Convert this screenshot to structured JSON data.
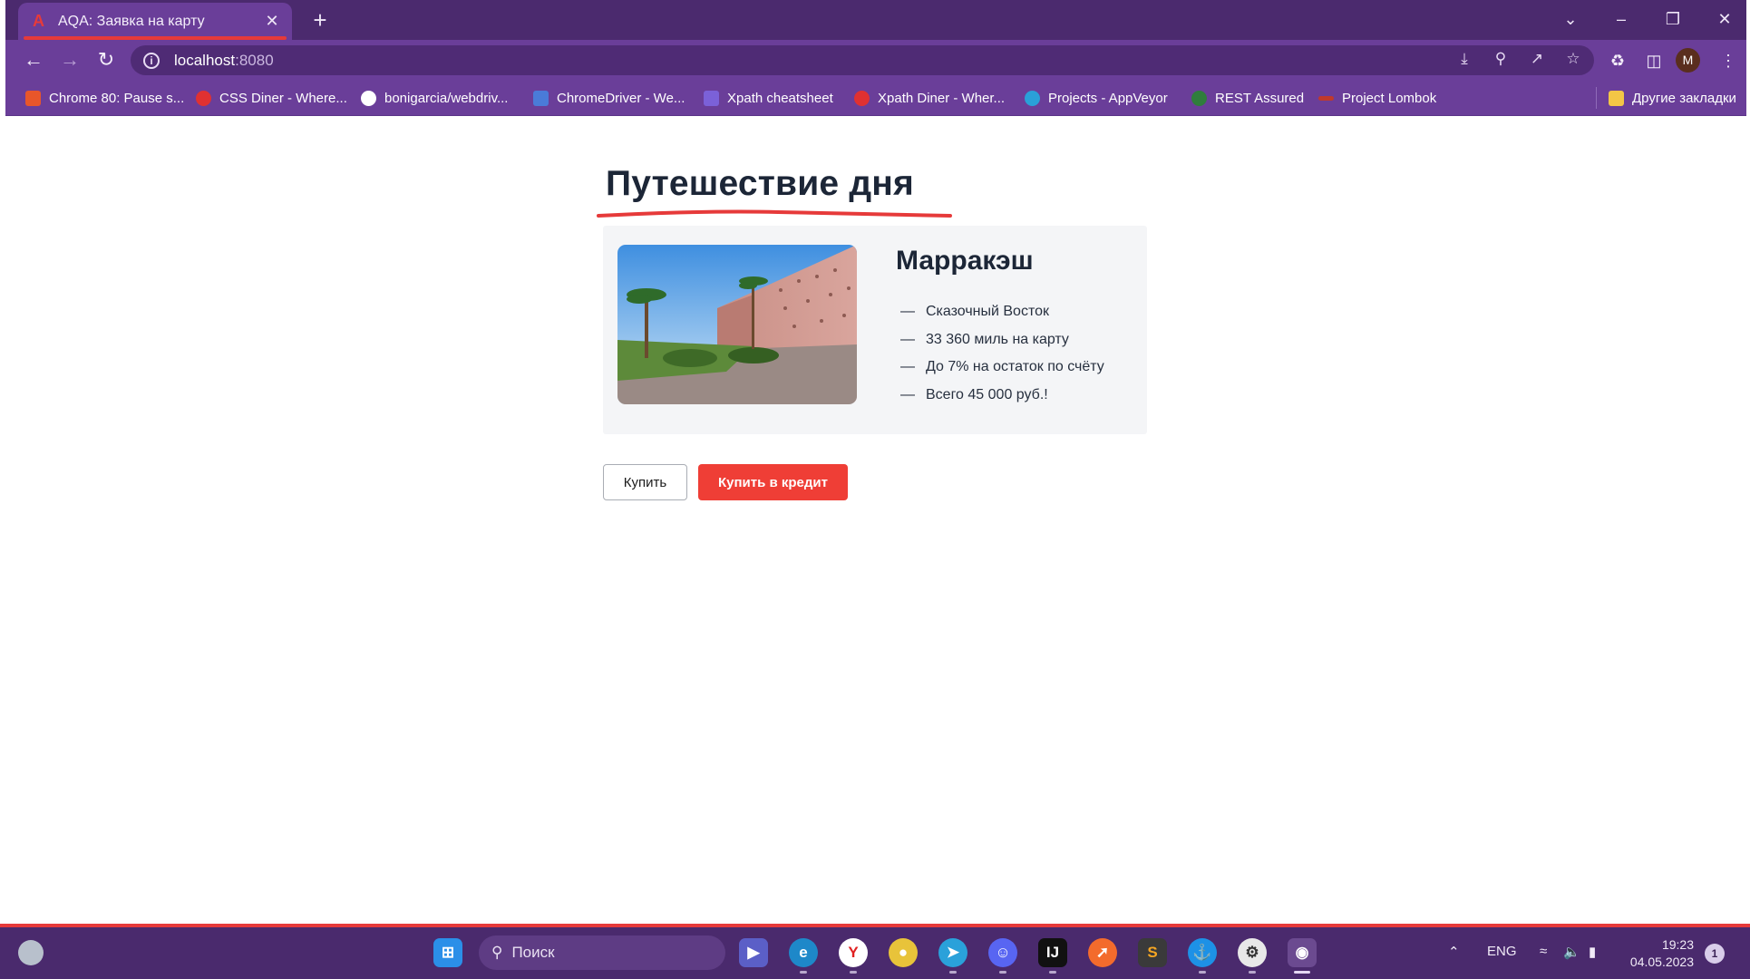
{
  "browser": {
    "tab_title": "AQA: Заявка на карту",
    "tab_close": "✕",
    "new_tab": "+",
    "url_host": "localhost",
    "url_port": ":8080",
    "avatar_letter": "M",
    "bookmarks": [
      {
        "label": "Chrome 80: Pause s...",
        "color": "#e8562a"
      },
      {
        "label": "CSS Diner - Where...",
        "color": "#e03131"
      },
      {
        "label": "bonigarcia/webdriv...",
        "color": "#ffffff"
      },
      {
        "label": "ChromeDriver - We...",
        "color": "#4a7bd8"
      },
      {
        "label": "Xpath cheatsheet",
        "color": "#7b61d8"
      },
      {
        "label": "Xpath Diner - Wher...",
        "color": "#e03131"
      },
      {
        "label": "Projects - AppVeyor",
        "color": "#2aa0d8"
      },
      {
        "label": "REST Assured",
        "color": "#2f7d3c"
      },
      {
        "label": "Project Lombok",
        "color": "#c0392b"
      }
    ],
    "other_bookmarks": "Другие закладки"
  },
  "page": {
    "heading": "Путешествие дня",
    "card": {
      "title": "Марракэш",
      "features": [
        "Сказочный Восток",
        "33 360 миль на карту",
        "До 7% на остаток по счёту",
        "Всего 45 000 руб.!"
      ],
      "dash": "—"
    },
    "buttons": {
      "buy": "Купить",
      "buy_credit": "Купить в кредит"
    },
    "accent_color": "#ef3e36"
  },
  "taskbar": {
    "search_placeholder": "Поиск",
    "language": "ENG",
    "time": "19:23",
    "date": "04.05.2023",
    "notifications": "1"
  }
}
